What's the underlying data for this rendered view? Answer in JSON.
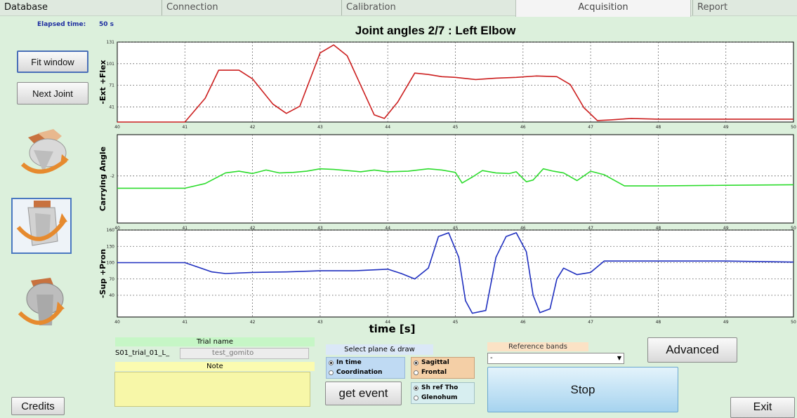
{
  "tabs": [
    {
      "label": "Database",
      "active": false
    },
    {
      "label": "Connection",
      "active": false
    },
    {
      "label": "Calibration",
      "active": false
    },
    {
      "label": "Acquisition",
      "active": true
    },
    {
      "label": "Report",
      "active": false
    }
  ],
  "status": {
    "elapsed_label": "Elapsed time:",
    "elapsed_value": "50 s"
  },
  "title": "Joint angles 2/7 : Left Elbow",
  "buttons": {
    "fit_window": "Fit window",
    "next_joint": "Next Joint",
    "credits": "Credits",
    "get_event": "get event",
    "advanced": "Advanced",
    "stop": "Stop",
    "exit": "Exit"
  },
  "joint_images": [
    "shoulder-flexion-image",
    "shoulder-abduction-image",
    "shoulder-rotation-image"
  ],
  "trial": {
    "name_label": "Trial name",
    "name_value": "S01_trial_01_L_",
    "name_field": "test_gomito",
    "note_label": "Note"
  },
  "plane": {
    "label": "Select plane & draw",
    "mode_options": [
      {
        "label": "In time",
        "selected": true
      },
      {
        "label": "Coordination",
        "selected": false
      }
    ],
    "plane_options": [
      {
        "label": "Sagittal",
        "selected": true
      },
      {
        "label": "Frontal",
        "selected": false
      }
    ],
    "reference_options": [
      {
        "label": "Sh ref Tho",
        "selected": true
      },
      {
        "label": "Glenohum",
        "selected": false
      }
    ]
  },
  "reference_bands": {
    "label": "Reference bands",
    "selected": "-"
  },
  "colors": {
    "series1": "#cc1f1f",
    "series2": "#2ddc2d",
    "series3": "#1f2fbf",
    "background": "#dcf0dc"
  },
  "chart_data": {
    "type": "line",
    "title": "Joint angles 2/7 : Left Elbow",
    "xlabel": "time [s]",
    "xlim": [
      40,
      50
    ],
    "xticks": [
      "40",
      "41",
      "42",
      "43",
      "44",
      "45",
      "46",
      "47",
      "48",
      "49",
      "50"
    ],
    "grid": true,
    "panels": [
      {
        "ylabel": "-Ext +Flex",
        "ylim": [
          20,
          131
        ],
        "yticks": [
          "131",
          "101",
          "71",
          "41"
        ],
        "series": [
          {
            "color": "#cc1f1f",
            "points": [
              [
                40,
                20
              ],
              [
                41,
                20
              ],
              [
                41.3,
                53
              ],
              [
                41.5,
                92
              ],
              [
                41.8,
                92
              ],
              [
                42,
                80
              ],
              [
                42.3,
                45
              ],
              [
                42.5,
                32
              ],
              [
                42.7,
                42
              ],
              [
                43,
                116
              ],
              [
                43.2,
                127
              ],
              [
                43.4,
                112
              ],
              [
                43.8,
                30
              ],
              [
                43.95,
                25
              ],
              [
                44.15,
                48
              ],
              [
                44.4,
                88
              ],
              [
                44.6,
                86
              ],
              [
                44.8,
                83
              ],
              [
                45,
                82
              ],
              [
                45.3,
                79
              ],
              [
                45.6,
                81
              ],
              [
                45.9,
                82
              ],
              [
                46.2,
                84
              ],
              [
                46.5,
                83
              ],
              [
                46.7,
                72
              ],
              [
                46.9,
                40
              ],
              [
                47.1,
                22
              ],
              [
                47.3,
                23
              ],
              [
                47.6,
                25
              ],
              [
                48,
                24
              ],
              [
                49,
                24
              ],
              [
                50,
                24
              ]
            ]
          }
        ]
      },
      {
        "ylabel": "Carrying Angle",
        "yticks": [
          "-2"
        ],
        "ylim": [
          -10,
          5
        ],
        "series": [
          {
            "color": "#2ddc2d",
            "points": [
              [
                40,
                -4.1
              ],
              [
                41,
                -4.1
              ],
              [
                41.3,
                -3.3
              ],
              [
                41.6,
                -1.5
              ],
              [
                41.8,
                -1.2
              ],
              [
                42,
                -1.6
              ],
              [
                42.2,
                -1.0
              ],
              [
                42.4,
                -1.5
              ],
              [
                42.6,
                -1.4
              ],
              [
                42.8,
                -1.2
              ],
              [
                43,
                -0.8
              ],
              [
                43.2,
                -0.9
              ],
              [
                43.4,
                -1.1
              ],
              [
                43.6,
                -1.3
              ],
              [
                43.8,
                -1.0
              ],
              [
                44,
                -1.3
              ],
              [
                44.3,
                -1.2
              ],
              [
                44.6,
                -0.8
              ],
              [
                44.8,
                -1.0
              ],
              [
                45,
                -1.4
              ],
              [
                45.1,
                -3.2
              ],
              [
                45.25,
                -2.2
              ],
              [
                45.4,
                -1.1
              ],
              [
                45.6,
                -1.5
              ],
              [
                45.8,
                -1.6
              ],
              [
                45.9,
                -1.3
              ],
              [
                46.05,
                -3.0
              ],
              [
                46.15,
                -2.7
              ],
              [
                46.3,
                -0.8
              ],
              [
                46.45,
                -1.2
              ],
              [
                46.6,
                -1.5
              ],
              [
                46.8,
                -2.8
              ],
              [
                47,
                -1.2
              ],
              [
                47.2,
                -1.8
              ],
              [
                47.5,
                -3.7
              ],
              [
                48,
                -3.7
              ],
              [
                49,
                -3.6
              ],
              [
                50,
                -3.5
              ]
            ]
          }
        ]
      },
      {
        "ylabel": "-Sup +Pron",
        "ylim": [
          0,
          160
        ],
        "yticks": [
          "160",
          "130",
          "100",
          "70",
          "40"
        ],
        "series": [
          {
            "color": "#1f2fbf",
            "points": [
              [
                40,
                100
              ],
              [
                41,
                100
              ],
              [
                41.4,
                83
              ],
              [
                41.6,
                80
              ],
              [
                42,
                82
              ],
              [
                42.5,
                83
              ],
              [
                43,
                85
              ],
              [
                43.5,
                85
              ],
              [
                44,
                88
              ],
              [
                44.2,
                80
              ],
              [
                44.4,
                70
              ],
              [
                44.6,
                90
              ],
              [
                44.75,
                148
              ],
              [
                44.9,
                155
              ],
              [
                45.05,
                110
              ],
              [
                45.15,
                30
              ],
              [
                45.25,
                7
              ],
              [
                45.45,
                12
              ],
              [
                45.6,
                110
              ],
              [
                45.75,
                148
              ],
              [
                45.9,
                155
              ],
              [
                46.05,
                120
              ],
              [
                46.15,
                40
              ],
              [
                46.25,
                8
              ],
              [
                46.4,
                15
              ],
              [
                46.5,
                70
              ],
              [
                46.6,
                90
              ],
              [
                46.8,
                78
              ],
              [
                47,
                82
              ],
              [
                47.2,
                103
              ],
              [
                48,
                103
              ],
              [
                49,
                103
              ],
              [
                50,
                101
              ]
            ]
          }
        ]
      }
    ]
  }
}
